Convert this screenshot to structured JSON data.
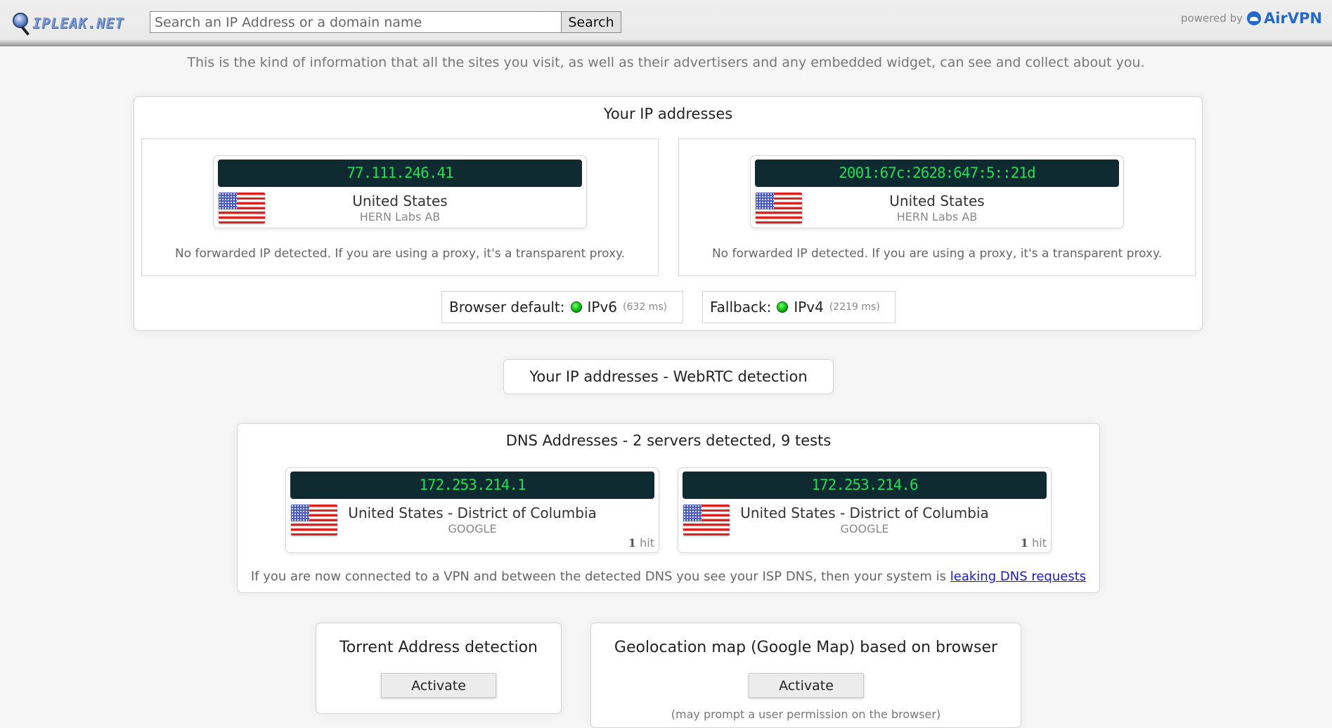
{
  "header": {
    "logo_text": "IPLEAK.NET",
    "search_placeholder": "Search an IP Address or a domain name",
    "search_value": "",
    "search_button": "Search",
    "powered_by": "powered by",
    "brand": "AirVPN",
    "brand_color": "#2669c8"
  },
  "tagline": "This is the kind of information that all the sites you visit, as well as their advertisers and any embedded widget, can see and collect about you.",
  "ip_section": {
    "title": "Your IP addresses",
    "addresses": [
      {
        "ip": "77.111.246.41",
        "country": "United States",
        "isp": "HERN Labs AB",
        "flag": "us-flag-icon",
        "forwarded_note": "No forwarded IP detected. If you are using a proxy, it's a transparent proxy."
      },
      {
        "ip": "2001:67c:2628:647:5::21d",
        "country": "United States",
        "isp": "HERN Labs AB",
        "flag": "us-flag-icon",
        "forwarded_note": "No forwarded IP detected. If you are using a proxy, it's a transparent proxy."
      }
    ],
    "browser_default": {
      "label": "Browser default:",
      "protocol": "IPv6",
      "latency": "(632 ms)",
      "status_color": "#22bb22"
    },
    "fallback": {
      "label": "Fallback:",
      "protocol": "IPv4",
      "latency": "(2219 ms)",
      "status_color": "#22bb22"
    }
  },
  "webrtc": {
    "button_label": "Your IP addresses - WebRTC detection"
  },
  "dns_section": {
    "title": "DNS Addresses - 2 servers detected, 9 tests",
    "servers": [
      {
        "ip": "172.253.214.1",
        "location": "United States - District of Columbia",
        "isp": "GOOGLE",
        "hits_count": "1",
        "hits_label": "hit"
      },
      {
        "ip": "172.253.214.6",
        "location": "United States - District of Columbia",
        "isp": "GOOGLE",
        "hits_count": "1",
        "hits_label": "hit"
      }
    ],
    "note": "If you are now connected to a VPN and between the detected DNS you see your ISP DNS, then your system is ",
    "note_link": "leaking DNS requests"
  },
  "torrent": {
    "title": "Torrent Address detection",
    "button": "Activate"
  },
  "geolocation": {
    "title": "Geolocation map (Google Map) based on browser",
    "button": "Activate",
    "note": "(may prompt a user permission on the browser)"
  }
}
